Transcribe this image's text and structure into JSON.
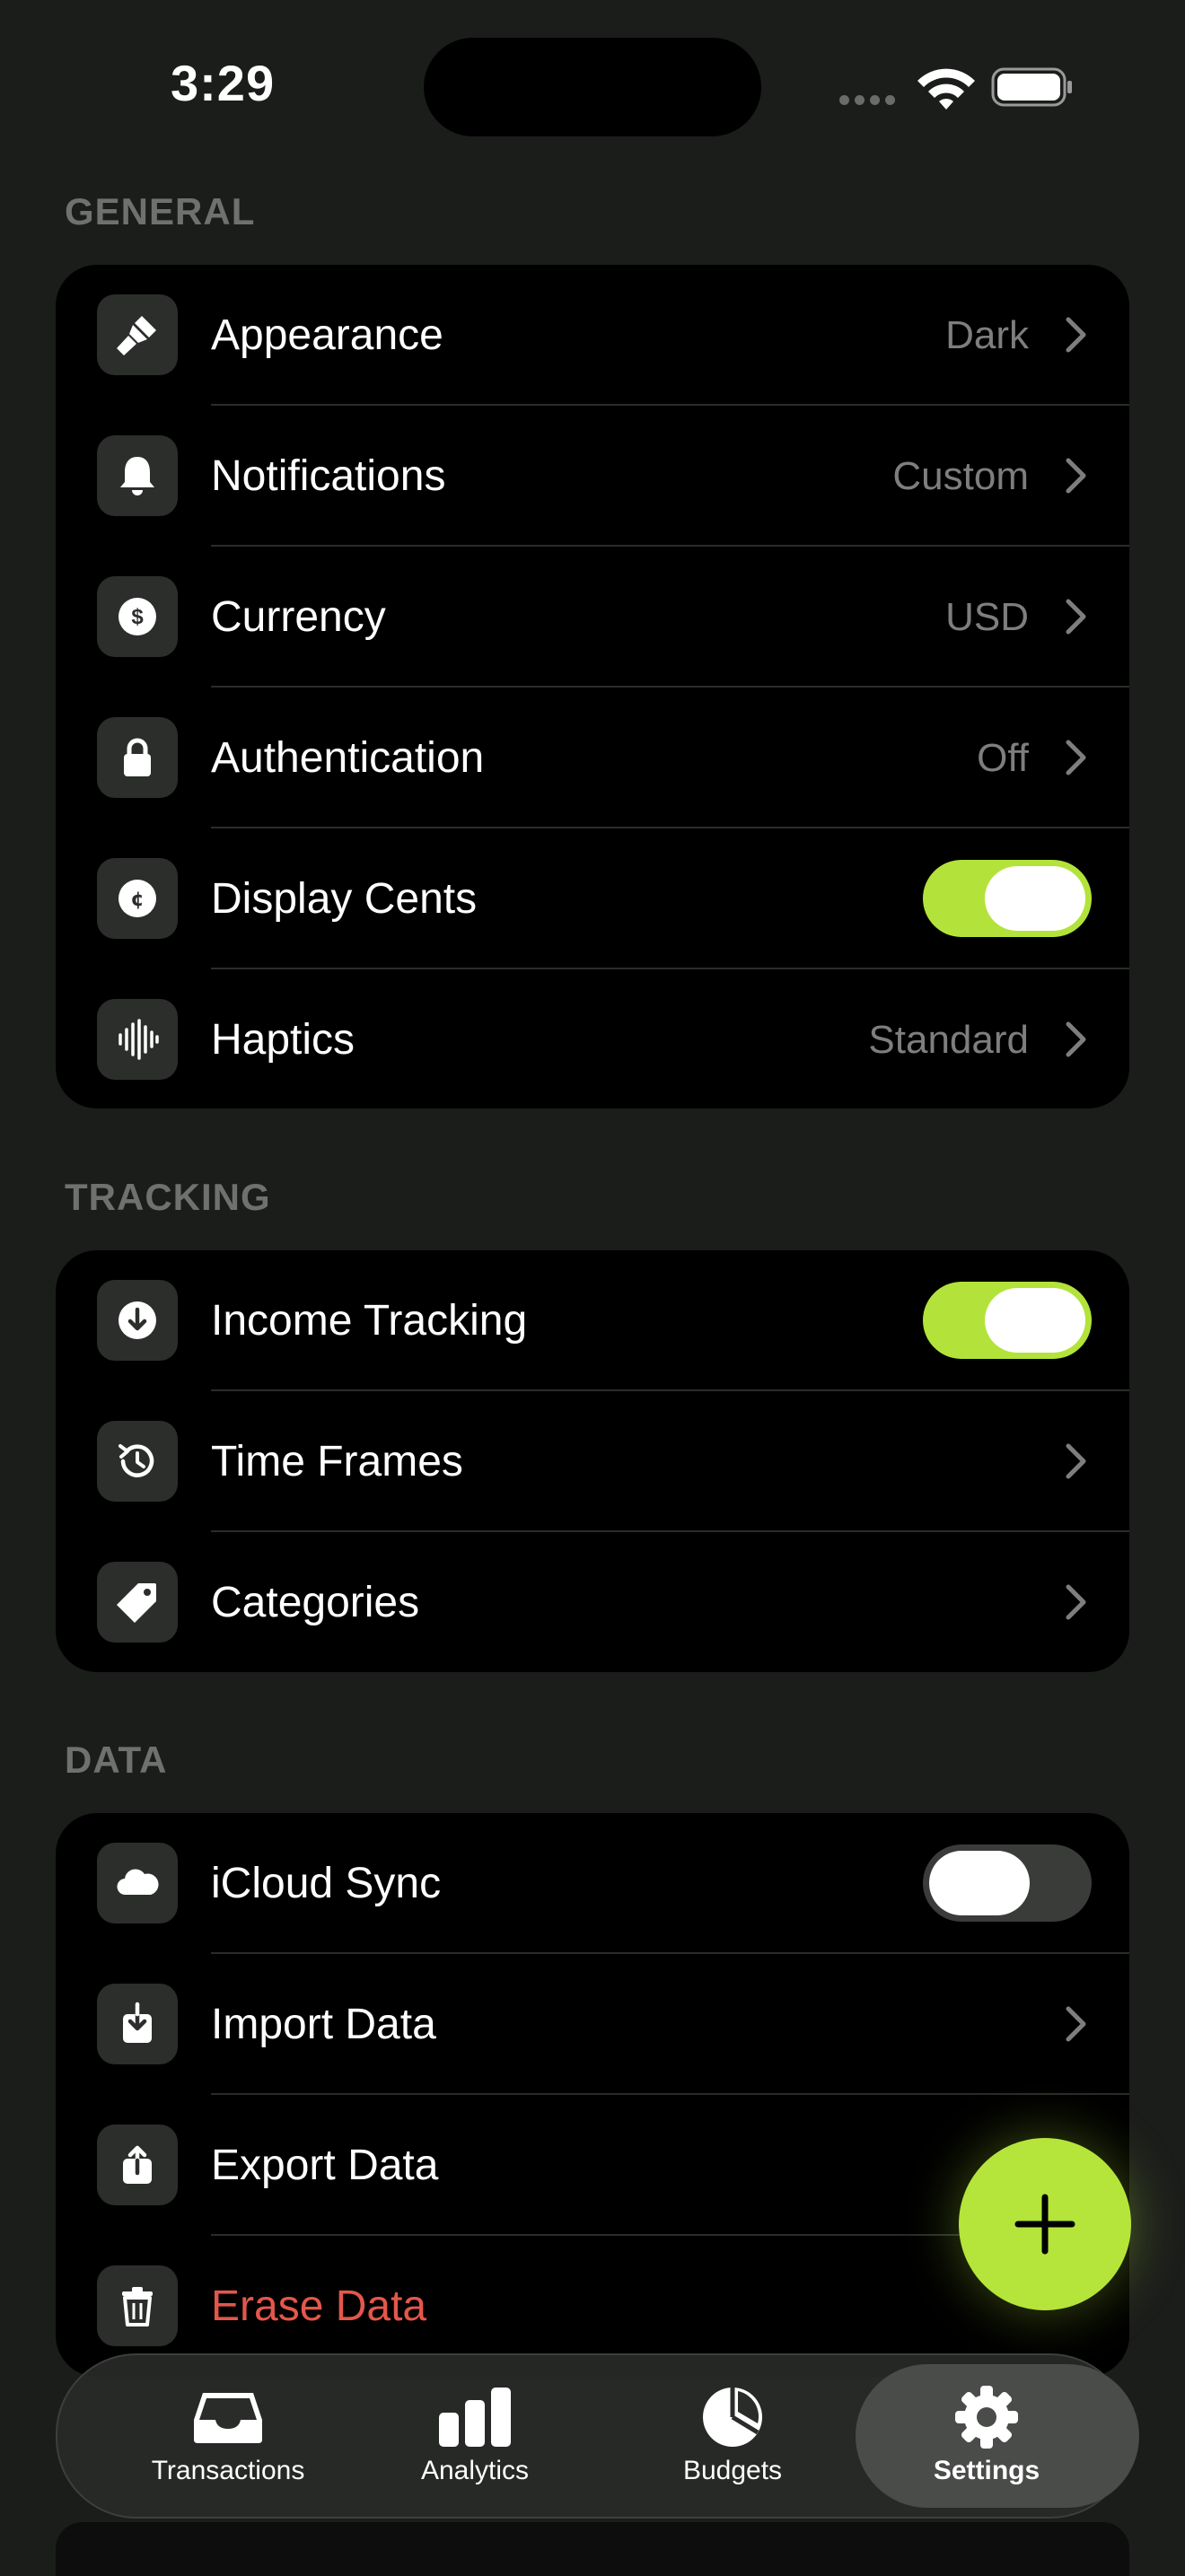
{
  "status": {
    "time": "3:29"
  },
  "sections": {
    "general": {
      "header": "GENERAL",
      "rows": [
        {
          "label": "Appearance",
          "value": "Dark",
          "icon": "paintbrush-icon"
        },
        {
          "label": "Notifications",
          "value": "Custom",
          "icon": "bell-icon"
        },
        {
          "label": "Currency",
          "value": "USD",
          "icon": "dollar-icon"
        },
        {
          "label": "Authentication",
          "value": "Off",
          "icon": "lock-icon"
        },
        {
          "label": "Display Cents",
          "toggle": true,
          "icon": "cent-icon"
        },
        {
          "label": "Haptics",
          "value": "Standard",
          "icon": "waveform-icon"
        }
      ]
    },
    "tracking": {
      "header": "TRACKING",
      "rows": [
        {
          "label": "Income Tracking",
          "toggle": true,
          "icon": "arrow-down-circle-icon"
        },
        {
          "label": "Time Frames",
          "icon": "history-icon"
        },
        {
          "label": "Categories",
          "icon": "tag-icon"
        }
      ]
    },
    "data": {
      "header": "DATA",
      "rows": [
        {
          "label": "iCloud Sync",
          "toggle": false,
          "icon": "cloud-icon"
        },
        {
          "label": "Import Data",
          "icon": "import-icon"
        },
        {
          "label": "Export Data",
          "icon": "export-icon"
        },
        {
          "label": "Erase Data",
          "icon": "trash-icon"
        }
      ]
    }
  },
  "tabs": [
    {
      "label": "Transactions",
      "icon": "tray-icon"
    },
    {
      "label": "Analytics",
      "icon": "bar-chart-icon"
    },
    {
      "label": "Budgets",
      "icon": "pie-chart-icon"
    },
    {
      "label": "Settings",
      "icon": "gear-icon",
      "active": true
    }
  ],
  "colors": {
    "accent": "#b3e33a",
    "danger": "#e3574b",
    "background": "#1b1d1b"
  }
}
